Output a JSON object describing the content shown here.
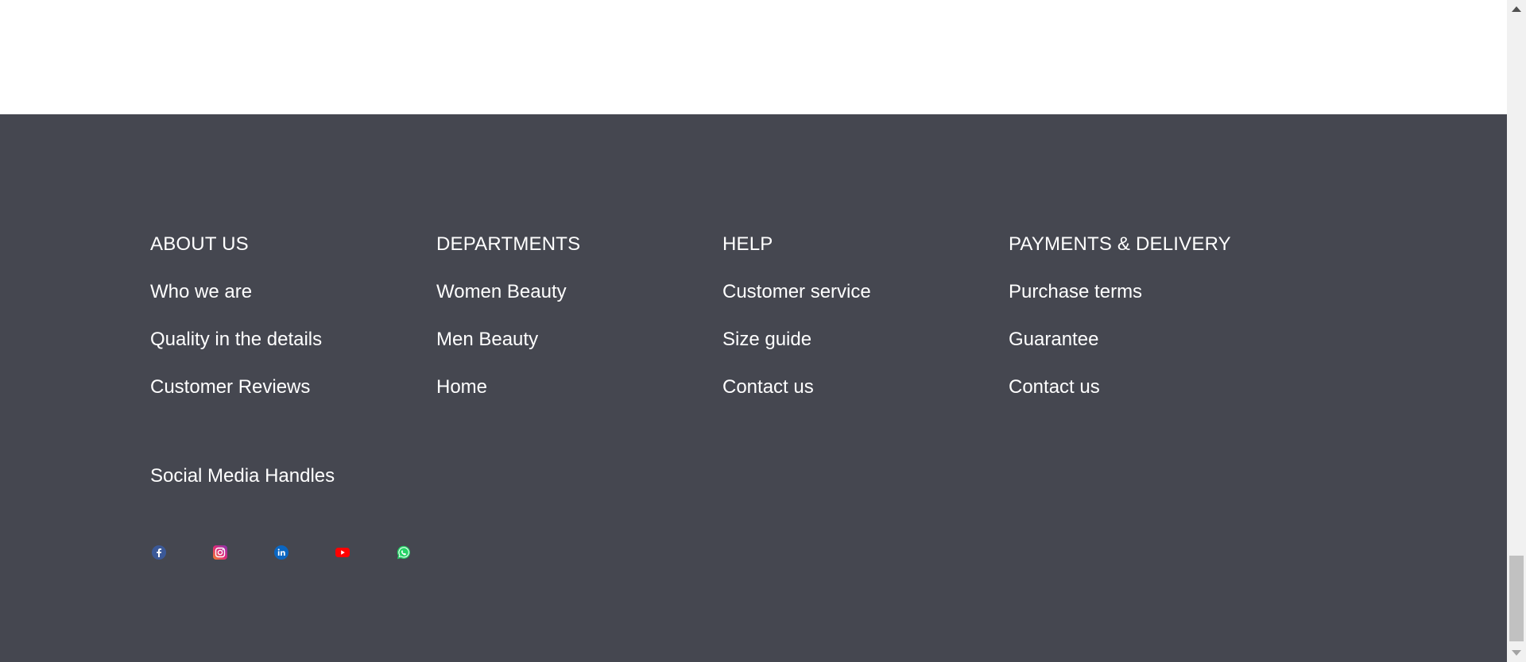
{
  "footer": {
    "columns": [
      {
        "heading": "ABOUT US",
        "links": [
          "Who we are",
          "Quality in the details",
          "Customer Reviews"
        ]
      },
      {
        "heading": "DEPARTMENTS",
        "links": [
          "Women Beauty",
          "Men Beauty",
          "Home"
        ]
      },
      {
        "heading": "HELP",
        "links": [
          "Customer service",
          "Size guide",
          "Contact us"
        ]
      },
      {
        "heading": "PAYMENTS & DELIVERY",
        "links": [
          "Purchase terms",
          "Guarantee",
          "Contact us"
        ]
      }
    ],
    "social": {
      "title": "Social Media Handles",
      "icons": [
        "facebook-icon",
        "instagram-icon",
        "linkedin-icon",
        "youtube-icon",
        "whatsapp-icon"
      ]
    }
  },
  "colors": {
    "footer_bg": "#454750",
    "text": "#ffffff",
    "facebook": "#3b5998",
    "instagram": "#c13584",
    "linkedin": "#0a66c2",
    "youtube": "#ff0000",
    "whatsapp": "#25d366"
  }
}
